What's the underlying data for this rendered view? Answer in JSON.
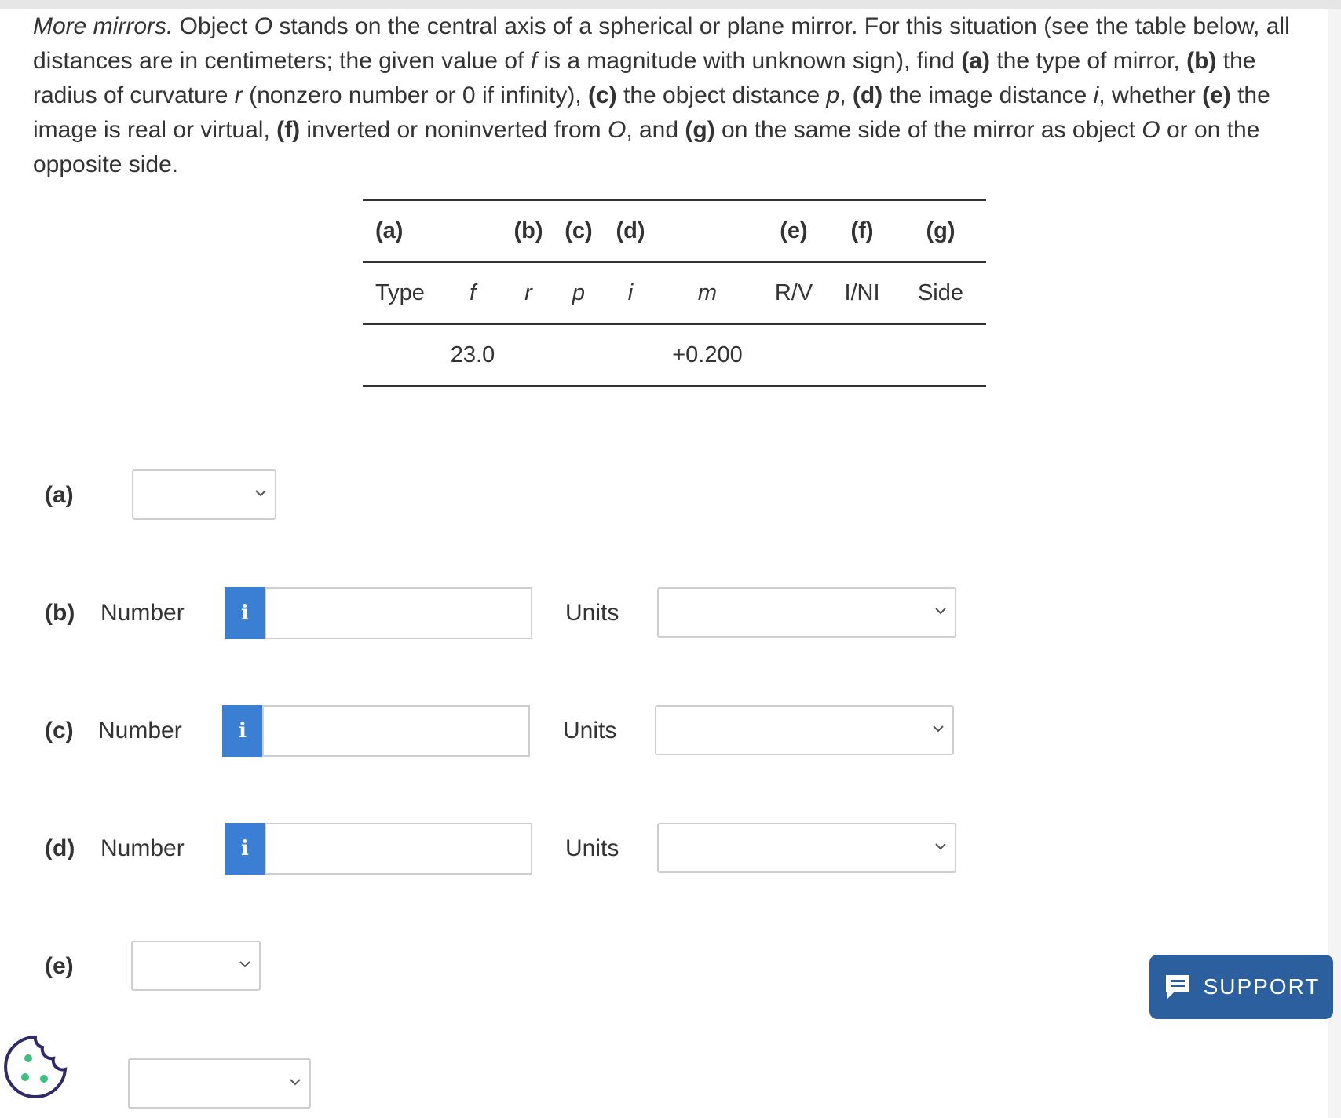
{
  "question": {
    "title": "More mirrors.",
    "text_1": " Object ",
    "O1": "O",
    "text_2": " stands on the central axis of a spherical or plane mirror. For this situation (see the table below, all distances are in centimeters; the given value of ",
    "f": "f",
    "text_3": " is a magnitude with unknown sign), find ",
    "a": "(a)",
    "text_4": " the type of mirror, ",
    "b": "(b)",
    "text_5": " the radius of curvature ",
    "r": "r",
    "text_6": " (nonzero number or 0 if infinity), ",
    "c": "(c)",
    "text_7": " the object distance ",
    "p": "p",
    "text_8": ", ",
    "d": "(d)",
    "text_9": " the image distance ",
    "i": "i",
    "text_10": ", whether ",
    "e": "(e)",
    "text_11": " the image is real or virtual, ",
    "f_part": "(f)",
    "text_12": " inverted or noninverted from ",
    "O2": "O",
    "text_13": ", and ",
    "g": "(g)",
    "text_14": " on the same side of the mirror as object ",
    "O3": "O",
    "text_15": " or on the opposite side."
  },
  "table": {
    "part_row": [
      "(a)",
      "",
      "(b)",
      "(c)",
      "(d)",
      "",
      "(e)",
      "(f)",
      "(g)"
    ],
    "header_row": [
      "Type",
      "f",
      "r",
      "p",
      "i",
      "m",
      "R/V",
      "I/NI",
      "Side"
    ],
    "value_row": [
      "",
      "23.0",
      "",
      "",
      "",
      "+0.200",
      "",
      "",
      ""
    ]
  },
  "answers": {
    "a_label": "(a)",
    "b_label": "(b)",
    "c_label": "(c)",
    "d_label": "(d)",
    "e_label": "(e)",
    "number_label": "Number",
    "units_label": "Units",
    "info_glyph": "i"
  },
  "support": {
    "label": "SUPPORT"
  },
  "colors": {
    "info_blue": "#3b7fd4",
    "support_blue": "#2b5f9e",
    "cookie_green": "#3fbf7f"
  }
}
